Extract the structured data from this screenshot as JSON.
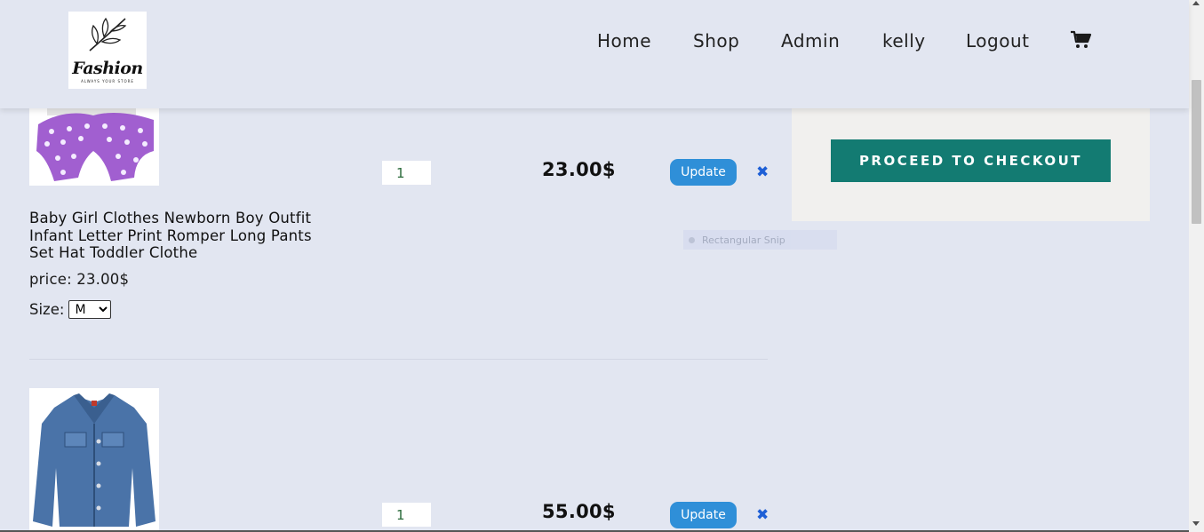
{
  "brand": {
    "name": "Fashion",
    "tagline": "ALWAYS YOUR STORE"
  },
  "nav": {
    "items": [
      {
        "label": "Home"
      },
      {
        "label": "Shop"
      },
      {
        "label": "Admin"
      },
      {
        "label": "kelly"
      },
      {
        "label": "Logout"
      }
    ],
    "cart_icon": "shopping-cart-icon"
  },
  "cart": {
    "items": [
      {
        "title": "Baby Girl Clothes Newborn Boy Outfit Infant Letter Print Romper Long Pants Set Hat Toddler Clothe",
        "price_label": "price: 23.00$",
        "size_label": "Size:",
        "size_value": "M",
        "quantity": "1",
        "line_total": "23.00$",
        "update_label": "Update",
        "remove_icon": "close-icon"
      },
      {
        "quantity": "1",
        "line_total": "55.00$",
        "update_label": "Update",
        "remove_icon": "close-icon"
      }
    ]
  },
  "summary": {
    "checkout_label": "PROCEED TO CHECKOUT"
  },
  "overlay": {
    "snip_label": "Rectangular Snip"
  },
  "colors": {
    "page_bg": "#e2e6f1",
    "checkout_button": "#137b72",
    "update_button": "#2f8fd8",
    "remove_icon": "#1e5fd6",
    "summary_panel": "#f1f0ee"
  }
}
